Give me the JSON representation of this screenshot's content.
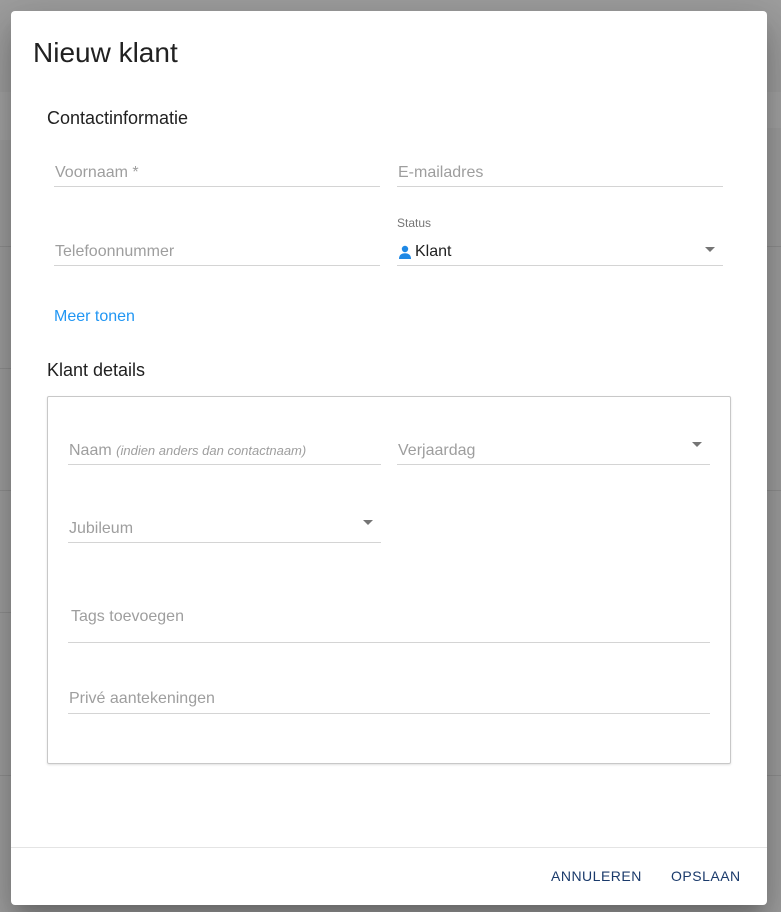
{
  "dialog": {
    "title": "Nieuw klant",
    "contact_section": {
      "title": "Contactinformatie",
      "first_name_placeholder": "Voornaam *",
      "email_placeholder": "E-mailadres",
      "phone_placeholder": "Telefoonnummer",
      "status": {
        "label": "Status",
        "value": "Klant",
        "icon": "person-icon"
      },
      "more_link": "Meer tonen"
    },
    "details_section": {
      "title": "Klant details",
      "name_placeholder": "Naam",
      "name_hint": "(indien anders dan contactnaam)",
      "birthday_placeholder": "Verjaardag",
      "anniversary_placeholder": "Jubileum",
      "tags_placeholder": "Tags toevoegen",
      "notes_placeholder": "Privé aantekeningen"
    },
    "actions": {
      "cancel": "ANNULEREN",
      "save": "OPSLAAN"
    }
  },
  "colors": {
    "accent": "#2196f3",
    "status_icon": "#1e88e5",
    "button_text": "#1a3a6b"
  }
}
